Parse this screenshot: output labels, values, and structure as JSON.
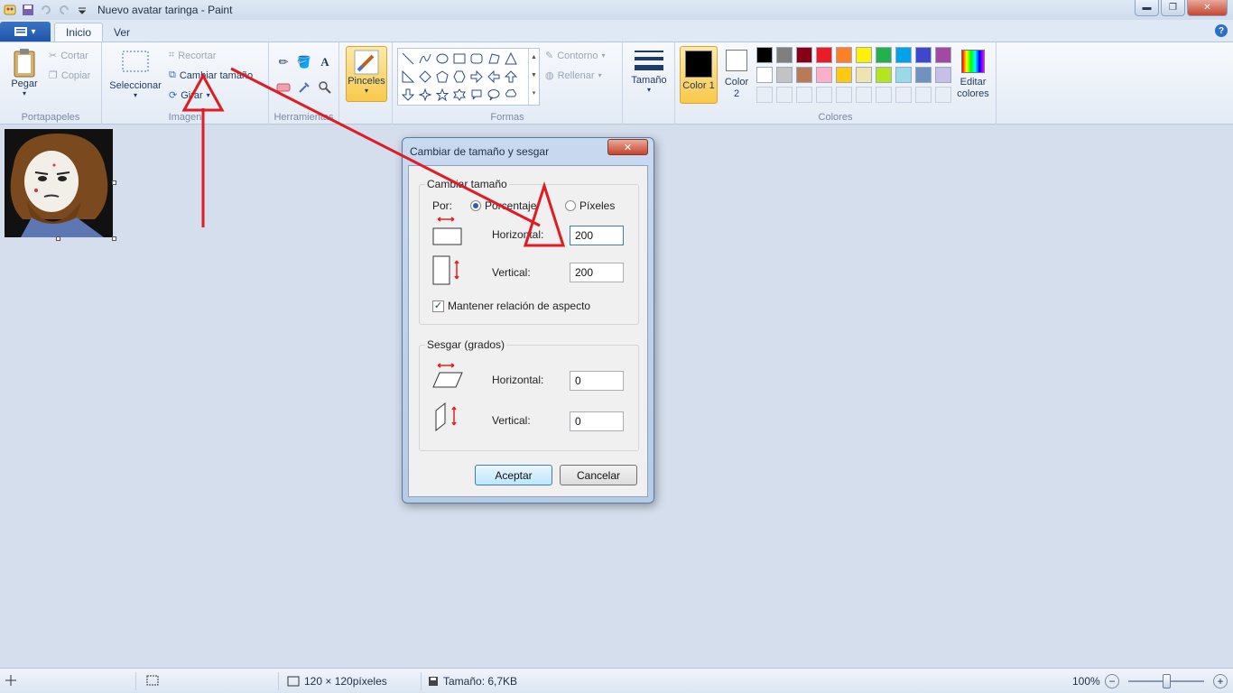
{
  "window": {
    "title": "Nuevo avatar taringa - Paint",
    "minimize": "▬",
    "maximize": "❐",
    "close": "✕"
  },
  "tabs": {
    "app_menu_arrow": "▾",
    "items": [
      "Inicio",
      "Ver"
    ],
    "help": "?"
  },
  "ribbon": {
    "clipboard": {
      "paste": "Pegar",
      "cut": "Cortar",
      "copy": "Copiar",
      "group": "Portapapeles"
    },
    "image": {
      "select": "Seleccionar",
      "crop": "Recortar",
      "resize": "Cambiar tamaño",
      "rotate": "Girar",
      "group": "Imagen"
    },
    "tools": {
      "group": "Herramientas",
      "text_tool": "A"
    },
    "brushes": {
      "label": "Pinceles"
    },
    "shapes": {
      "outline": "Contorno",
      "fill": "Rellenar",
      "group": "Formas"
    },
    "size": {
      "label": "Tamaño"
    },
    "colors": {
      "color1": "Color 1",
      "color2": "Color 2",
      "edit": "Editar colores",
      "group": "Colores",
      "palette_row1": [
        "#000000",
        "#7f7f7f",
        "#880015",
        "#ed1c24",
        "#ff7f27",
        "#fff200",
        "#22b14c",
        "#00a2e8",
        "#3f48cc",
        "#a349a4"
      ],
      "palette_row2": [
        "#ffffff",
        "#c3c3c3",
        "#b97a57",
        "#ffaec9",
        "#ffc90e",
        "#efe4b0",
        "#b5e61d",
        "#99d9ea",
        "#7092be",
        "#c8bfe7"
      ],
      "color1_value": "#000000",
      "color2_value": "#ffffff"
    }
  },
  "dialog": {
    "title": "Cambiar de tamaño y sesgar",
    "close": "✕",
    "resize_legend": "Cambiar tamaño",
    "by_label": "Por:",
    "percent": "Porcentaje",
    "pixels": "Píxeles",
    "horizontal_label": "Horizontal:",
    "vertical_label": "Vertical:",
    "horizontal_value": "200",
    "vertical_value": "200",
    "keep_ratio": "Mantener relación de aspecto",
    "keep_ratio_mark": "✓",
    "skew_legend": "Sesgar (grados)",
    "skew_horizontal_label": "Horizontal:",
    "skew_vertical_label": "Vertical:",
    "skew_horizontal_value": "0",
    "skew_vertical_value": "0",
    "ok": "Aceptar",
    "cancel": "Cancelar"
  },
  "statusbar": {
    "dimensions": "120 × 120píxeles",
    "filesize": "Tamaño: 6,7KB",
    "zoom": "100%",
    "zoom_out": "−",
    "zoom_in": "+",
    "zoom_level": 1.0
  }
}
